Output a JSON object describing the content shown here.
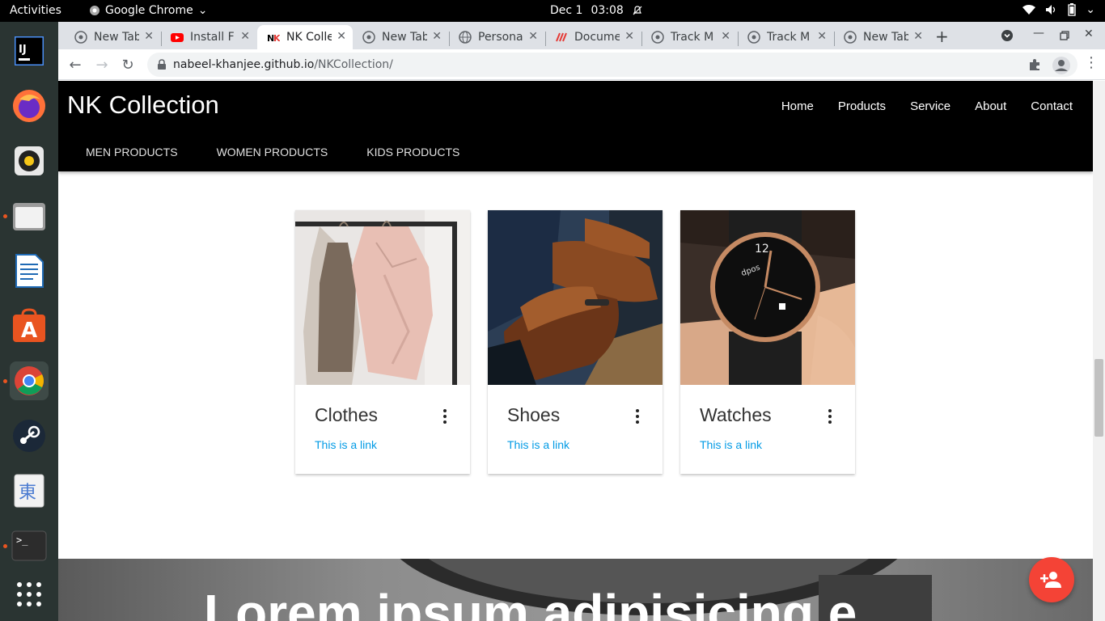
{
  "system": {
    "activities": "Activities",
    "app_name": "Google Chrome",
    "date": "Dec 1",
    "time": "03:08"
  },
  "tabs": [
    {
      "title": "New Tab",
      "icon": "chrome-icon"
    },
    {
      "title": "Install F",
      "icon": "youtube-icon"
    },
    {
      "title": "NK Colle",
      "icon": "nk-icon",
      "active": true
    },
    {
      "title": "New Tab",
      "icon": "chrome-icon"
    },
    {
      "title": "Persona",
      "icon": "globe-icon"
    },
    {
      "title": "Docume",
      "icon": "docs-icon"
    },
    {
      "title": "Track M",
      "icon": "chrome-icon"
    },
    {
      "title": "Track M",
      "icon": "chrome-icon"
    },
    {
      "title": "New Tab",
      "icon": "chrome-icon"
    }
  ],
  "address_bar": {
    "domain": "nabeel-khanjee.github.io",
    "path": "/NKCollection/"
  },
  "site": {
    "brand": "NK Collection",
    "nav": [
      "Home",
      "Products",
      "Service",
      "About",
      "Contact"
    ],
    "subnav": [
      "MEN PRODUCTS",
      "WOMEN PRODUCTS",
      "KIDS PRODUCTS"
    ],
    "cards": [
      {
        "title": "Clothes",
        "link": "This is a link"
      },
      {
        "title": "Shoes",
        "link": "This is a link"
      },
      {
        "title": "Watches",
        "link": "This is a link"
      }
    ],
    "hero_text": "Lorem ipsum adipisicing e"
  },
  "colors": {
    "accent_link": "#039be5",
    "fab": "#f44336",
    "header_bg": "#000000"
  }
}
